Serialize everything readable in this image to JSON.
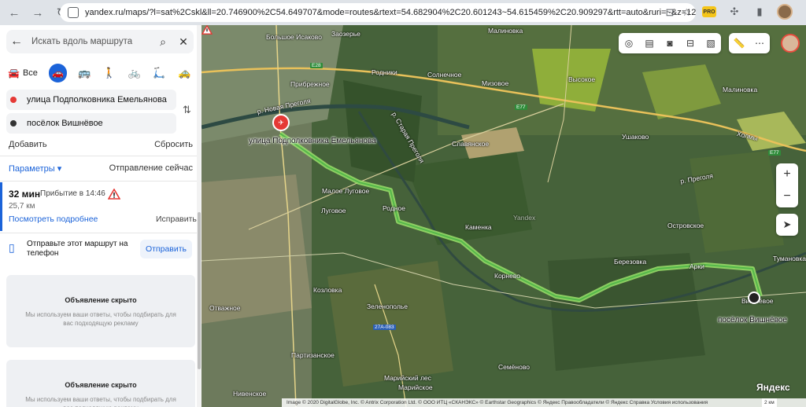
{
  "browser": {
    "url": "yandex.ru/maps/?l=sat%2Cskl&ll=20.746900%2C54.649707&mode=routes&rtext=54.682904%2C20.601243~54.615459%2C20.909297&rtt=auto&ruri=~&z=12"
  },
  "panel": {
    "search_placeholder": "Искать вдоль маршрута",
    "modes": {
      "all_label": "Все"
    },
    "from": "улица Подполковника Емельянова",
    "to": "посёлок Вишнёвое",
    "add_label": "Добавить",
    "reset_label": "Сбросить",
    "params_label": "Параметры ▾",
    "depart_label": "Отправление сейчас",
    "route": {
      "duration": "32 мин",
      "arrival": "Прибытие в 14:46",
      "distance": "25,7 км",
      "details_label": "Посмотреть подробнее",
      "fix_label": "Исправить"
    },
    "send": {
      "text": "Отправьте этот маршрут на телефон",
      "button": "Отправить"
    },
    "ads": [
      {
        "title": "Объявление скрыто",
        "text": "Мы используем ваши ответы, чтобы подбирать для вас подходящую рекламу"
      },
      {
        "title": "Объявление скрыто",
        "text": "Мы используем ваши ответы, чтобы подбирать для вас подходящую рекламу"
      }
    ]
  },
  "map": {
    "labels": {
      "bolshoe_isakovo": "Большое Исаково",
      "zaozerye": "Заозерье",
      "malinovka_n": "Малиновка",
      "pribrezhnoe": "Прибрежное",
      "rodniki": "Родники",
      "solnechnoe": "Солнечное",
      "mizovoe": "Мизовое",
      "vysokoe": "Высокое",
      "malinovka_e": "Малиновка",
      "novaya_pregolya": "р. Новая Преголя",
      "staraya_pregolya": "р. Старая Преголя",
      "slavyanskoe": "Славянское",
      "ushakovo": "Ушаково",
      "kholmy": "Холмы",
      "pregolya_e": "р. Преголя",
      "podpolkovnika": "улица Подполковника Емельянова",
      "maloe_lugovoe": "Малое Луговое",
      "lugovoe": "Луговое",
      "rodnoe": "Родное",
      "kamenka": "Каменка",
      "ostrovskoe": "Островское",
      "tumanovka": "Тумановка",
      "berezovka": "Березовка",
      "kozlovka": "Козловка",
      "otvazhnoe": "Отважное",
      "zelenopolye": "Зеленополье",
      "partizanskoe": "Партизанское",
      "semenovo": "Семёново",
      "marisky_les": "Марийский лес",
      "mariskoe": "Марийское",
      "nivenskoe": "Нивенское",
      "vishnevoe": "посёлок Вишнёвое",
      "arki": "Арки",
      "kornevo": "Корнево",
      "vishnevoe_small": "Вишнёвое",
      "yandex_wm": "Yandex"
    },
    "road_tags": [
      "E28",
      "E77",
      "E77",
      "27А-083"
    ],
    "attribution": "Image © 2020 DigitalGlobe, Inc. © Antrix Corporation Ltd. © ООО ИТЦ «СКАНЭКС» © Earthstar Geographics © Яндекс   Правообладатели   © Яндекс   Справка   Условия использования",
    "scale": "2 км",
    "logo": "Яндекс"
  }
}
